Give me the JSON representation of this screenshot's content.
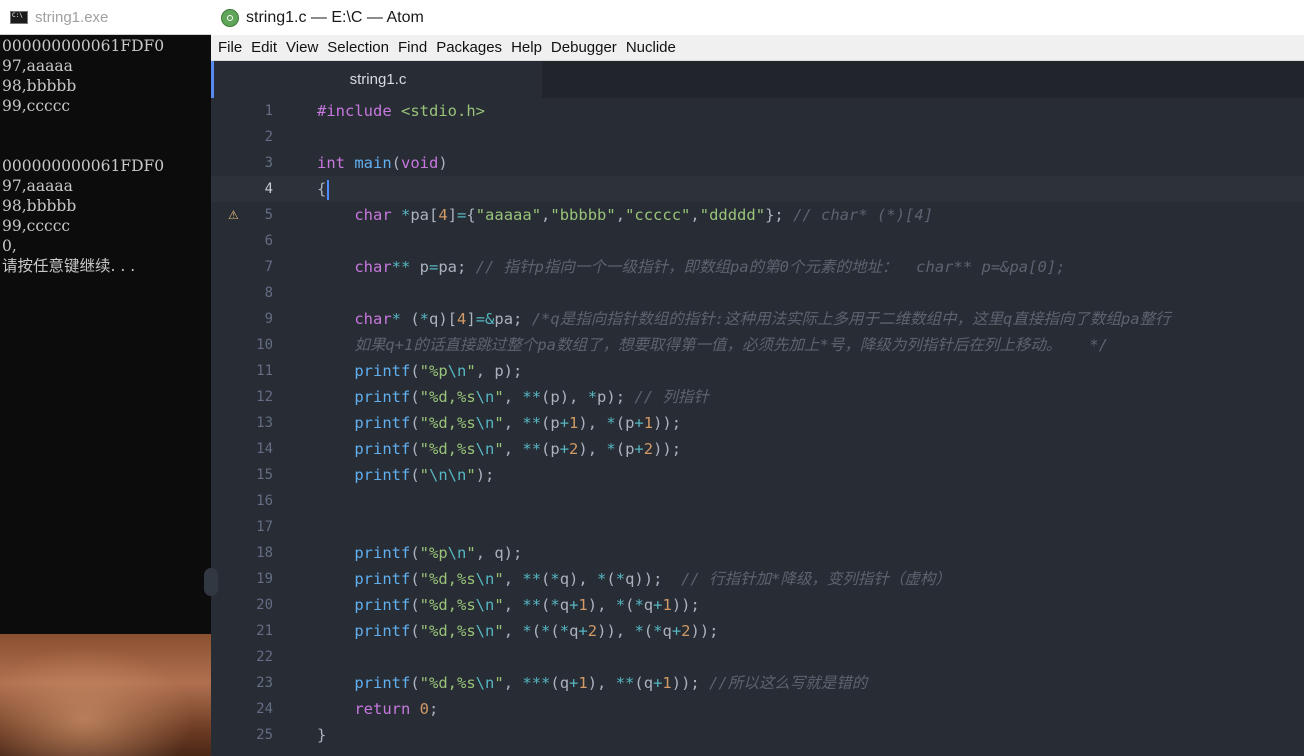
{
  "console": {
    "title": "string1.exe",
    "lines": [
      "000000000061FDF0",
      "97,aaaaa",
      "98,bbbbb",
      "99,ccccc",
      "",
      "",
      "000000000061FDF0",
      "97,aaaaa",
      "98,bbbbb",
      "99,ccccc",
      "0,",
      "请按任意键继续. . ."
    ]
  },
  "atom": {
    "title": "string1.c — E:\\C — Atom",
    "menu": [
      "File",
      "Edit",
      "View",
      "Selection",
      "Find",
      "Packages",
      "Help",
      "Debugger",
      "Nuclide"
    ],
    "tab": "string1.c",
    "cursor_line": 4,
    "warning_line": 5,
    "lines": [
      {
        "n": "1",
        "tokens": [
          [
            "pp",
            "#include "
          ],
          [
            "inc",
            "<stdio.h>"
          ]
        ]
      },
      {
        "n": "2",
        "tokens": []
      },
      {
        "n": "3",
        "tokens": [
          [
            "t",
            "int "
          ],
          [
            "f",
            "main"
          ],
          [
            "p",
            "("
          ],
          [
            "t",
            "void"
          ],
          [
            "p",
            ")"
          ]
        ]
      },
      {
        "n": "4",
        "tokens": [
          [
            "p",
            "{"
          ]
        ]
      },
      {
        "n": "5",
        "tokens": [
          [
            "p",
            "    "
          ],
          [
            "t",
            "char "
          ],
          [
            "o",
            "*"
          ],
          [
            "p",
            "pa["
          ],
          [
            "n",
            "4"
          ],
          [
            "p",
            "]"
          ],
          [
            "o",
            "="
          ],
          [
            "p",
            "{"
          ],
          [
            "s",
            "\"aaaaa\""
          ],
          [
            "p",
            ","
          ],
          [
            "s",
            "\"bbbbb\""
          ],
          [
            "p",
            ","
          ],
          [
            "s",
            "\"ccccc\""
          ],
          [
            "p",
            ","
          ],
          [
            "s",
            "\"ddddd\""
          ],
          [
            "p",
            "}; "
          ],
          [
            "c",
            "// char* (*)[4]"
          ]
        ]
      },
      {
        "n": "6",
        "tokens": []
      },
      {
        "n": "7",
        "tokens": [
          [
            "p",
            "    "
          ],
          [
            "t",
            "char"
          ],
          [
            "o",
            "**"
          ],
          [
            "p",
            " p"
          ],
          [
            "o",
            "="
          ],
          [
            "p",
            "pa; "
          ],
          [
            "c",
            "// 指针p指向一个一级指针，即数组pa的第0个元素的地址：  char** p=&pa[0];"
          ]
        ]
      },
      {
        "n": "8",
        "tokens": []
      },
      {
        "n": "9",
        "tokens": [
          [
            "p",
            "    "
          ],
          [
            "t",
            "char"
          ],
          [
            "o",
            "*"
          ],
          [
            "p",
            " ("
          ],
          [
            "o",
            "*"
          ],
          [
            "p",
            "q)["
          ],
          [
            "n",
            "4"
          ],
          [
            "p",
            "]"
          ],
          [
            "o",
            "=&"
          ],
          [
            "p",
            "pa; "
          ],
          [
            "c",
            "/*q是指向指针数组的指针:这种用法实际上多用于二维数组中，这里q直接指向了数组pa整行"
          ]
        ]
      },
      {
        "n": "10",
        "tokens": [
          [
            "c",
            "    如果q+1的话直接跳过整个pa数组了，想要取得第一值，必须先加上*号，降级为列指针后在列上移动。   */"
          ]
        ]
      },
      {
        "n": "11",
        "tokens": [
          [
            "p",
            "    "
          ],
          [
            "f",
            "printf"
          ],
          [
            "p",
            "("
          ],
          [
            "s",
            "\"%p"
          ],
          [
            "o",
            "\\n"
          ],
          [
            "s",
            "\""
          ],
          [
            "p",
            ", p);"
          ]
        ]
      },
      {
        "n": "12",
        "tokens": [
          [
            "p",
            "    "
          ],
          [
            "f",
            "printf"
          ],
          [
            "p",
            "("
          ],
          [
            "s",
            "\"%d,%s"
          ],
          [
            "o",
            "\\n"
          ],
          [
            "s",
            "\""
          ],
          [
            "p",
            ", "
          ],
          [
            "o",
            "**"
          ],
          [
            "p",
            "(p), "
          ],
          [
            "o",
            "*"
          ],
          [
            "p",
            "p); "
          ],
          [
            "c",
            "// 列指针"
          ]
        ]
      },
      {
        "n": "13",
        "tokens": [
          [
            "p",
            "    "
          ],
          [
            "f",
            "printf"
          ],
          [
            "p",
            "("
          ],
          [
            "s",
            "\"%d,%s"
          ],
          [
            "o",
            "\\n"
          ],
          [
            "s",
            "\""
          ],
          [
            "p",
            ", "
          ],
          [
            "o",
            "**"
          ],
          [
            "p",
            "(p"
          ],
          [
            "o",
            "+"
          ],
          [
            "n",
            "1"
          ],
          [
            "p",
            "), "
          ],
          [
            "o",
            "*"
          ],
          [
            "p",
            "(p"
          ],
          [
            "o",
            "+"
          ],
          [
            "n",
            "1"
          ],
          [
            "p",
            "));"
          ]
        ]
      },
      {
        "n": "14",
        "tokens": [
          [
            "p",
            "    "
          ],
          [
            "f",
            "printf"
          ],
          [
            "p",
            "("
          ],
          [
            "s",
            "\"%d,%s"
          ],
          [
            "o",
            "\\n"
          ],
          [
            "s",
            "\""
          ],
          [
            "p",
            ", "
          ],
          [
            "o",
            "**"
          ],
          [
            "p",
            "(p"
          ],
          [
            "o",
            "+"
          ],
          [
            "n",
            "2"
          ],
          [
            "p",
            "), "
          ],
          [
            "o",
            "*"
          ],
          [
            "p",
            "(p"
          ],
          [
            "o",
            "+"
          ],
          [
            "n",
            "2"
          ],
          [
            "p",
            "));"
          ]
        ]
      },
      {
        "n": "15",
        "tokens": [
          [
            "p",
            "    "
          ],
          [
            "f",
            "printf"
          ],
          [
            "p",
            "("
          ],
          [
            "s",
            "\""
          ],
          [
            "o",
            "\\n\\n"
          ],
          [
            "s",
            "\""
          ],
          [
            "p",
            ");"
          ]
        ]
      },
      {
        "n": "16",
        "tokens": []
      },
      {
        "n": "17",
        "tokens": []
      },
      {
        "n": "18",
        "tokens": [
          [
            "p",
            "    "
          ],
          [
            "f",
            "printf"
          ],
          [
            "p",
            "("
          ],
          [
            "s",
            "\"%p"
          ],
          [
            "o",
            "\\n"
          ],
          [
            "s",
            "\""
          ],
          [
            "p",
            ", q);"
          ]
        ]
      },
      {
        "n": "19",
        "tokens": [
          [
            "p",
            "    "
          ],
          [
            "f",
            "printf"
          ],
          [
            "p",
            "("
          ],
          [
            "s",
            "\"%d,%s"
          ],
          [
            "o",
            "\\n"
          ],
          [
            "s",
            "\""
          ],
          [
            "p",
            ", "
          ],
          [
            "o",
            "**"
          ],
          [
            "p",
            "("
          ],
          [
            "o",
            "*"
          ],
          [
            "p",
            "q), "
          ],
          [
            "o",
            "*"
          ],
          [
            "p",
            "("
          ],
          [
            "o",
            "*"
          ],
          [
            "p",
            "q));  "
          ],
          [
            "c",
            "// 行指针加*降级，变列指针（虚构）"
          ]
        ]
      },
      {
        "n": "20",
        "tokens": [
          [
            "p",
            "    "
          ],
          [
            "f",
            "printf"
          ],
          [
            "p",
            "("
          ],
          [
            "s",
            "\"%d,%s"
          ],
          [
            "o",
            "\\n"
          ],
          [
            "s",
            "\""
          ],
          [
            "p",
            ", "
          ],
          [
            "o",
            "**"
          ],
          [
            "p",
            "("
          ],
          [
            "o",
            "*"
          ],
          [
            "p",
            "q"
          ],
          [
            "o",
            "+"
          ],
          [
            "n",
            "1"
          ],
          [
            "p",
            "), "
          ],
          [
            "o",
            "*"
          ],
          [
            "p",
            "("
          ],
          [
            "o",
            "*"
          ],
          [
            "p",
            "q"
          ],
          [
            "o",
            "+"
          ],
          [
            "n",
            "1"
          ],
          [
            "p",
            "));"
          ]
        ]
      },
      {
        "n": "21",
        "tokens": [
          [
            "p",
            "    "
          ],
          [
            "f",
            "printf"
          ],
          [
            "p",
            "("
          ],
          [
            "s",
            "\"%d,%s"
          ],
          [
            "o",
            "\\n"
          ],
          [
            "s",
            "\""
          ],
          [
            "p",
            ", "
          ],
          [
            "o",
            "*"
          ],
          [
            "p",
            "("
          ],
          [
            "o",
            "*"
          ],
          [
            "p",
            "("
          ],
          [
            "o",
            "*"
          ],
          [
            "p",
            "q"
          ],
          [
            "o",
            "+"
          ],
          [
            "n",
            "2"
          ],
          [
            "p",
            ")), "
          ],
          [
            "o",
            "*"
          ],
          [
            "p",
            "("
          ],
          [
            "o",
            "*"
          ],
          [
            "p",
            "q"
          ],
          [
            "o",
            "+"
          ],
          [
            "n",
            "2"
          ],
          [
            "p",
            "));"
          ]
        ]
      },
      {
        "n": "22",
        "tokens": []
      },
      {
        "n": "23",
        "tokens": [
          [
            "p",
            "    "
          ],
          [
            "f",
            "printf"
          ],
          [
            "p",
            "("
          ],
          [
            "s",
            "\"%d,%s"
          ],
          [
            "o",
            "\\n"
          ],
          [
            "s",
            "\""
          ],
          [
            "p",
            ", "
          ],
          [
            "o",
            "***"
          ],
          [
            "p",
            "(q"
          ],
          [
            "o",
            "+"
          ],
          [
            "n",
            "1"
          ],
          [
            "p",
            "), "
          ],
          [
            "o",
            "**"
          ],
          [
            "p",
            "(q"
          ],
          [
            "o",
            "+"
          ],
          [
            "n",
            "1"
          ],
          [
            "p",
            ")); "
          ],
          [
            "c",
            "//所以这么写就是错的"
          ]
        ]
      },
      {
        "n": "24",
        "tokens": [
          [
            "p",
            "    "
          ],
          [
            "k",
            "return "
          ],
          [
            "n",
            "0"
          ],
          [
            "p",
            ";"
          ]
        ]
      },
      {
        "n": "25",
        "tokens": [
          [
            "p",
            "}"
          ]
        ]
      }
    ]
  }
}
